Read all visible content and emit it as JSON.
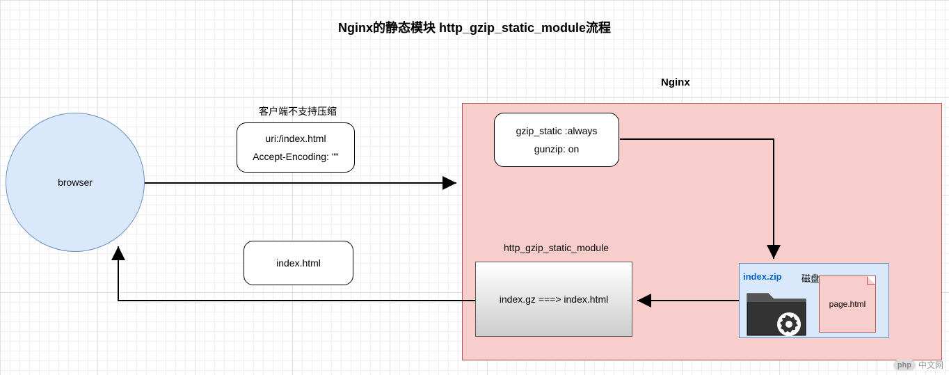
{
  "title": "Nginx的静态模块 http_gzip_static_module流程",
  "nginx_label": "Nginx",
  "browser_label": "browser",
  "client_support_label": "客户端不支持压缩",
  "request": {
    "uri": "uri:/index.html",
    "accept": "Accept-Encoding: \"\""
  },
  "response_label": "index.html",
  "config": {
    "gzip_static": "gzip_static :always",
    "gunzip": "gunzip: on"
  },
  "module_label": "http_gzip_static_module",
  "module_text": "index.gz ===> index.html",
  "disk": {
    "zip_label": "index.zip",
    "label": "磁盘",
    "page": "page.html"
  },
  "watermark": {
    "pill": "php",
    "text": "中文网"
  }
}
